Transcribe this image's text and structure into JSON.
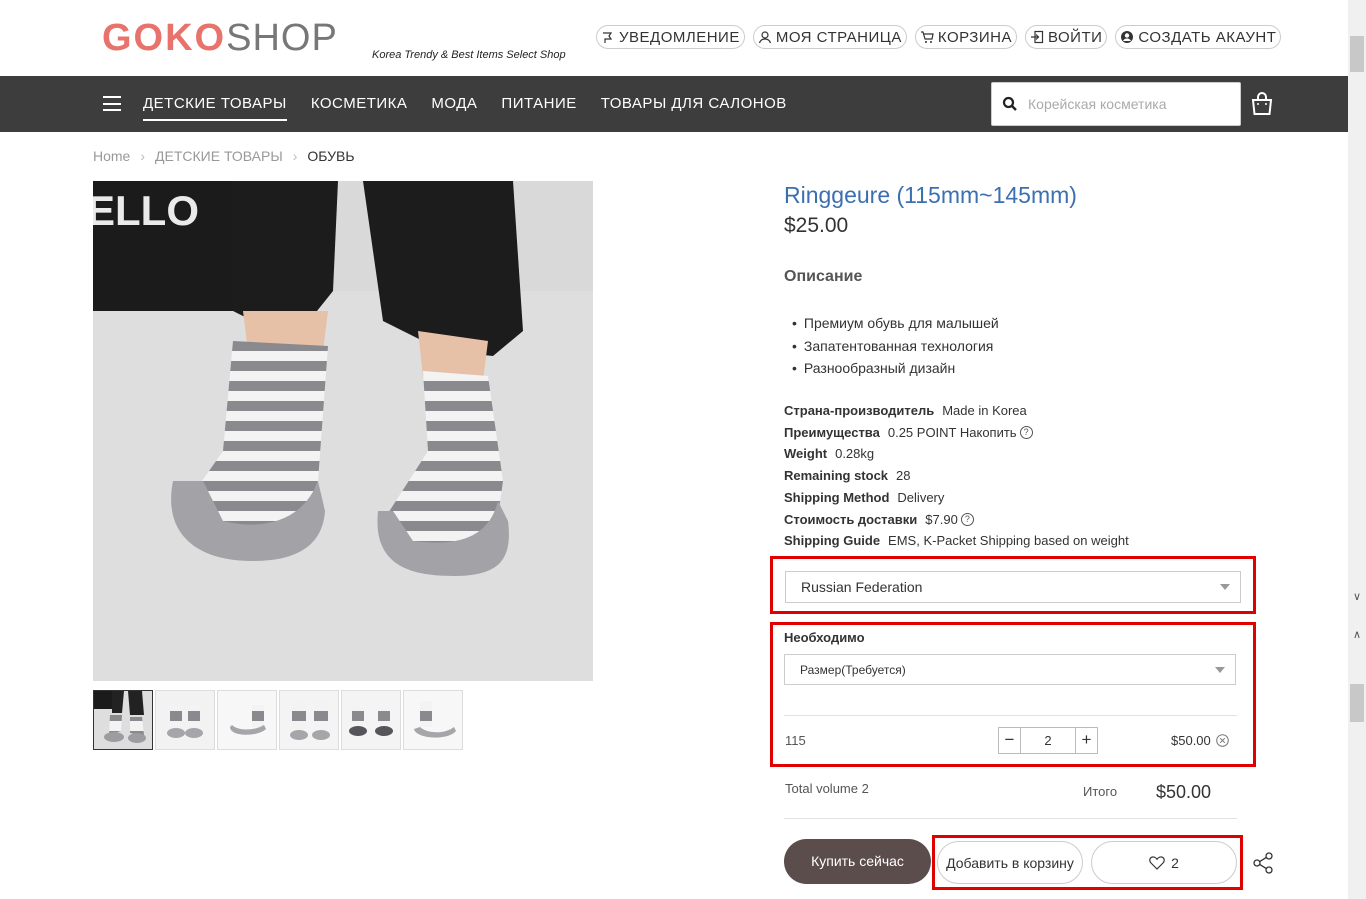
{
  "header": {
    "logo_brand": "GOKO",
    "logo_shop": "SHOP",
    "tagline": "Korea Trendy & Best Items Select Shop",
    "links": [
      {
        "label": "УВЕДОМЛЕНИЕ",
        "icon": "megaphone-icon"
      },
      {
        "label": "МОЯ СТРАНИЦА",
        "icon": "user-icon"
      },
      {
        "label": "КОРЗИНА",
        "icon": "cart-icon"
      },
      {
        "label": "ВОЙТИ",
        "icon": "login-icon"
      },
      {
        "label": "СОЗДАТЬ АКАУНТ",
        "icon": "account-circle-icon"
      }
    ]
  },
  "nav": {
    "items": [
      "ДЕТСКИЕ ТОВАРЫ",
      "КОСМЕТИКА",
      "МОДА",
      "ПИТАНИЕ",
      "ТОВАРЫ ДЛЯ САЛОНОВ"
    ],
    "active_index": 0,
    "search_placeholder": "Корейская косметика"
  },
  "breadcrumb": {
    "items": [
      "Home",
      "ДЕТСКИЕ ТОВАРЫ",
      "ОБУВЬ"
    ]
  },
  "gallery": {
    "main_wall_text": "ELLO",
    "thumb_count": 6,
    "active_thumb": 0
  },
  "product": {
    "title": "Ringgeure (115mm~145mm)",
    "price": "$25.00",
    "description_heading": "Описание",
    "bullets": [
      "Премиум обувь для малышей",
      "Запатентованная технология",
      "Разнообразный дизайн"
    ],
    "specs": [
      {
        "key": "Страна-производитель",
        "value": "Made in Korea",
        "help": false
      },
      {
        "key": "Преимущества",
        "value": "0.25 POINT Накопить",
        "help": true
      },
      {
        "key": "Weight",
        "value": "0.28kg",
        "help": false
      },
      {
        "key": "Remaining stock",
        "value": "28",
        "help": false
      },
      {
        "key": "Shipping Method",
        "value": "Delivery",
        "help": false
      },
      {
        "key": "Стоимость доставки",
        "value": "$7.90",
        "help": true
      },
      {
        "key": "Shipping Guide",
        "value": "EMS, K-Packet Shipping based on weight",
        "help": false
      }
    ]
  },
  "order": {
    "country": "Russian Federation",
    "required_label": "Необходимо",
    "size_select": "Размер(Требуется)",
    "line_size": "115",
    "quantity": "2",
    "line_price": "$50.00",
    "total_volume": "Total volume 2",
    "total_label": "Итого",
    "total_value": "$50.00"
  },
  "actions": {
    "buy_now": "Купить сейчас",
    "add_to_cart": "Добавить в корзину",
    "wish_count": "2"
  },
  "colors": {
    "accent_title": "#3b6fb0",
    "nav_bg": "#3d3d3d",
    "buy_button": "#5a4d4b",
    "highlight_box": "#e00000",
    "logo_brand": "#e8736c"
  }
}
